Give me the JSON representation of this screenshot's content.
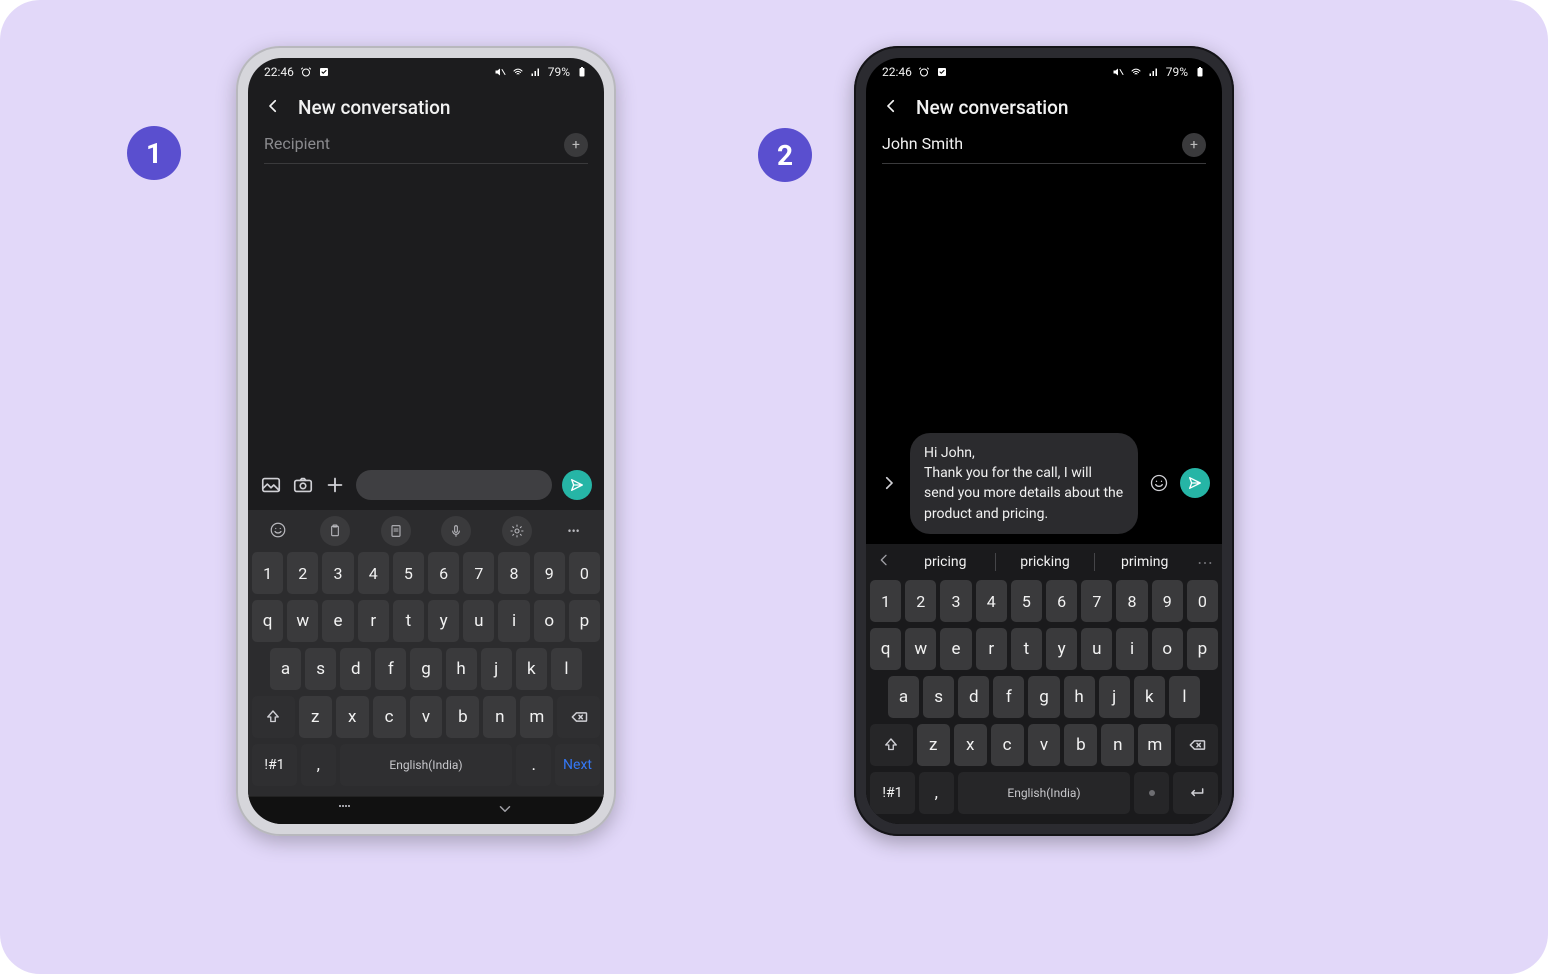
{
  "badges": [
    "1",
    "2"
  ],
  "status": {
    "time": "22:46",
    "battery": "79%"
  },
  "header": {
    "title": "New conversation"
  },
  "phone1": {
    "recipient_placeholder": "Recipient"
  },
  "phone2": {
    "recipient_value": "John Smith",
    "draft": "Hi John,\nThank you for the call, I will send you more details about the product and pricing.",
    "suggestions": [
      "pricing",
      "pricking",
      "priming"
    ]
  },
  "keyboard": {
    "row_num": [
      "1",
      "2",
      "3",
      "4",
      "5",
      "6",
      "7",
      "8",
      "9",
      "0"
    ],
    "row_q": [
      "q",
      "w",
      "e",
      "r",
      "t",
      "y",
      "u",
      "i",
      "o",
      "p"
    ],
    "row_a": [
      "a",
      "s",
      "d",
      "f",
      "g",
      "h",
      "j",
      "k",
      "l"
    ],
    "row_z": [
      "z",
      "x",
      "c",
      "v",
      "b",
      "n",
      "m"
    ],
    "sym": "!#1",
    "comma": ",",
    "space_label": "English(India)",
    "period": ".",
    "next": "Next"
  }
}
